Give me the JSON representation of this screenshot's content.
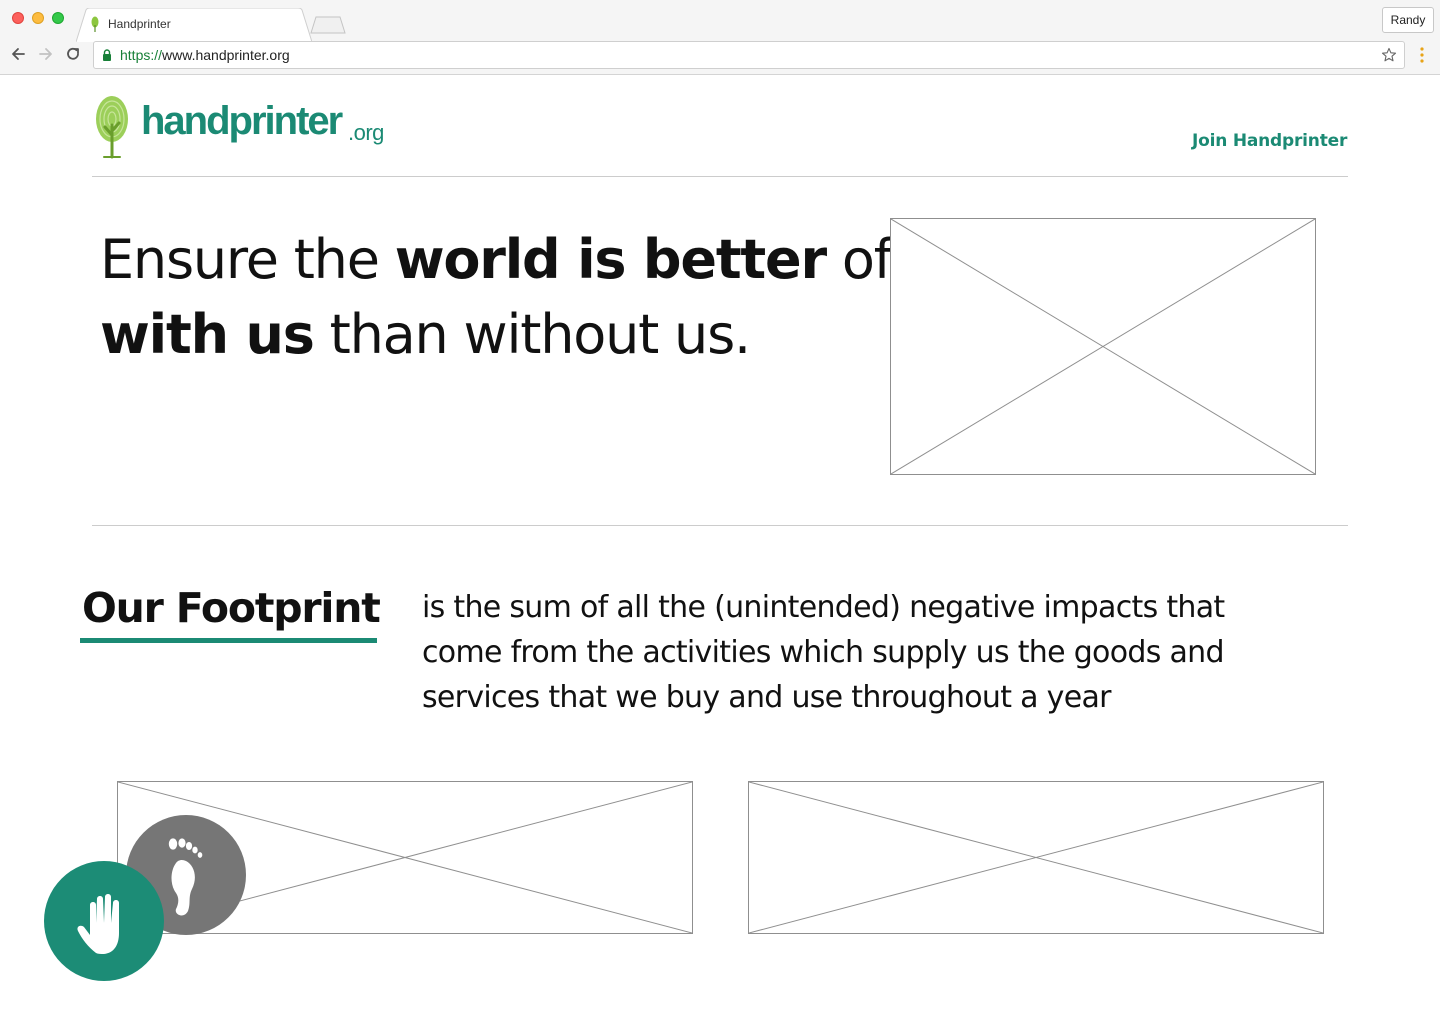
{
  "browser": {
    "tab_title": "Handprinter",
    "profile_name": "Randy",
    "url_scheme": "https://",
    "url_host": "www.handprinter.org"
  },
  "header": {
    "logo_text": "handprinter",
    "logo_tld": ".org",
    "join_label": "Join Handprinter"
  },
  "hero": {
    "line1_normal_a": "Ensure the ",
    "line1_bold": "world is better",
    "line1_normal_b": " off",
    "line2_bold": "with us",
    "line2_normal": " than without us."
  },
  "footprint": {
    "title": "Our Footprint",
    "lines": [
      "is the sum of all the (unintended) negative impacts that",
      "come from the activities which supply us the goods and",
      "services that we buy and use throughout a year"
    ]
  },
  "colors": {
    "brand": "#1b8a74",
    "hand_badge": "#1c8c76",
    "foot_badge": "#767676"
  },
  "icons": {
    "hand": "hand-icon",
    "foot": "footprint-icon",
    "tree": "tree-logo-icon"
  }
}
